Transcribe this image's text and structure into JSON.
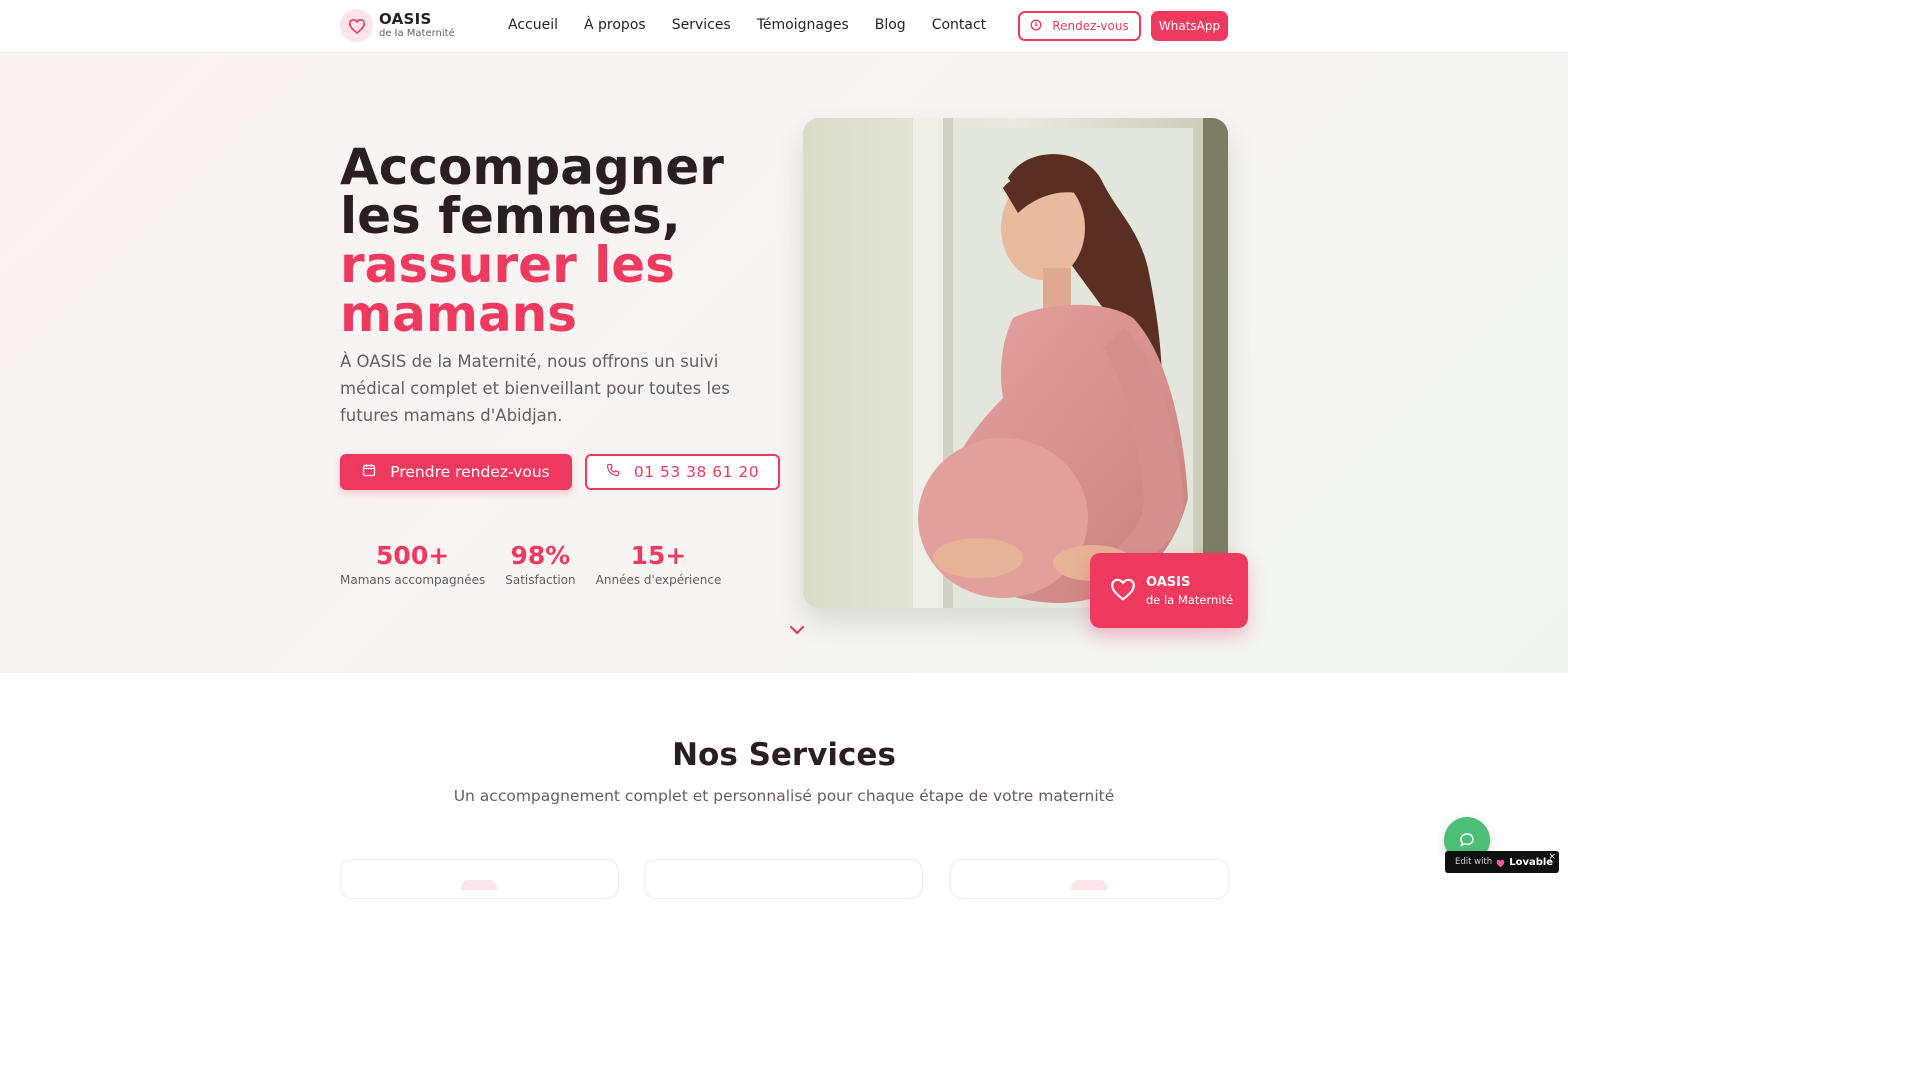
{
  "brand": {
    "title": "OASIS",
    "subtitle": "de la Maternité"
  },
  "nav": [
    {
      "label": "Accueil"
    },
    {
      "label": "À propos"
    },
    {
      "label": "Services"
    },
    {
      "label": "Témoignages"
    },
    {
      "label": "Blog"
    },
    {
      "label": "Contact"
    }
  ],
  "header_buttons": {
    "appointment": "Rendez-vous",
    "whatsapp": "WhatsApp"
  },
  "hero": {
    "title_line1": "Accompagner les femmes,",
    "title_accent": "rassurer les mamans",
    "description": "À OASIS de la Maternité, nous offrons un suivi médical complet et bienveillant pour toutes les futures mamans d'Abidjan.",
    "cta_primary": "Prendre rendez-vous",
    "cta_phone": "01 53 38 61 20",
    "stats": [
      {
        "value": "500+",
        "label": "Mamans accompagnées"
      },
      {
        "value": "98%",
        "label": "Satisfaction"
      },
      {
        "value": "15+",
        "label": "Années d'expérience"
      }
    ],
    "badge": {
      "title": "OASIS",
      "subtitle": "de la Maternité"
    }
  },
  "services": {
    "title": "Nos Services",
    "subtitle": "Un accompagnement complet et personnalisé pour chaque étape de votre maternité"
  },
  "lovable": {
    "edit": "Edit with",
    "brand": "Lovable",
    "close": "×"
  },
  "colors": {
    "accent": "#f0395f",
    "text": "#2a1e22",
    "muted": "#6b5b60",
    "chat": "#4cbe78"
  },
  "icons": {
    "logo": "heart-icon",
    "appointment": "clock-icon",
    "calendar": "calendar-icon",
    "phone": "phone-icon",
    "scroll": "chevron-down-icon",
    "chat": "chat-bubble-icon"
  }
}
